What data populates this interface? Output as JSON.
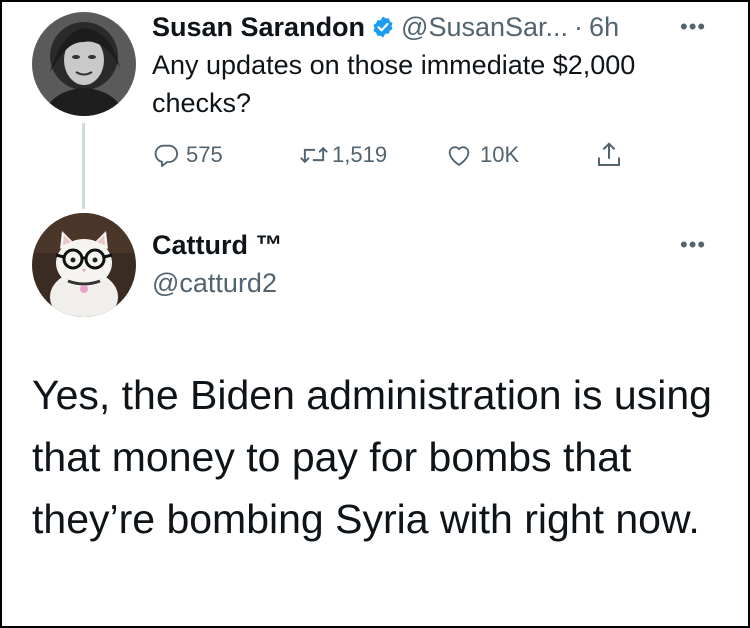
{
  "tweet1": {
    "display_name": "Susan Sarandon",
    "handle": "@SusanSar...",
    "separator": "·",
    "time": "6h",
    "more_label": "•••",
    "text": "Any updates on those immediate $2,000 checks?",
    "actions": {
      "replies": "575",
      "retweets": "1,519",
      "likes": "10K"
    },
    "icons": [
      "verified-badge-icon",
      "reply-icon",
      "retweet-icon",
      "like-icon",
      "share-icon"
    ]
  },
  "tweet2": {
    "display_name": "Catturd ™",
    "handle": "@catturd2",
    "more_label": "•••",
    "text": "Yes, the Biden administration is using that money to pay for bombs that they’re bombing Syria with right now."
  },
  "colors": {
    "text": "#0f1419",
    "secondary": "#536471",
    "verified": "#1d9bf0",
    "thread_line": "#cfd9de"
  }
}
